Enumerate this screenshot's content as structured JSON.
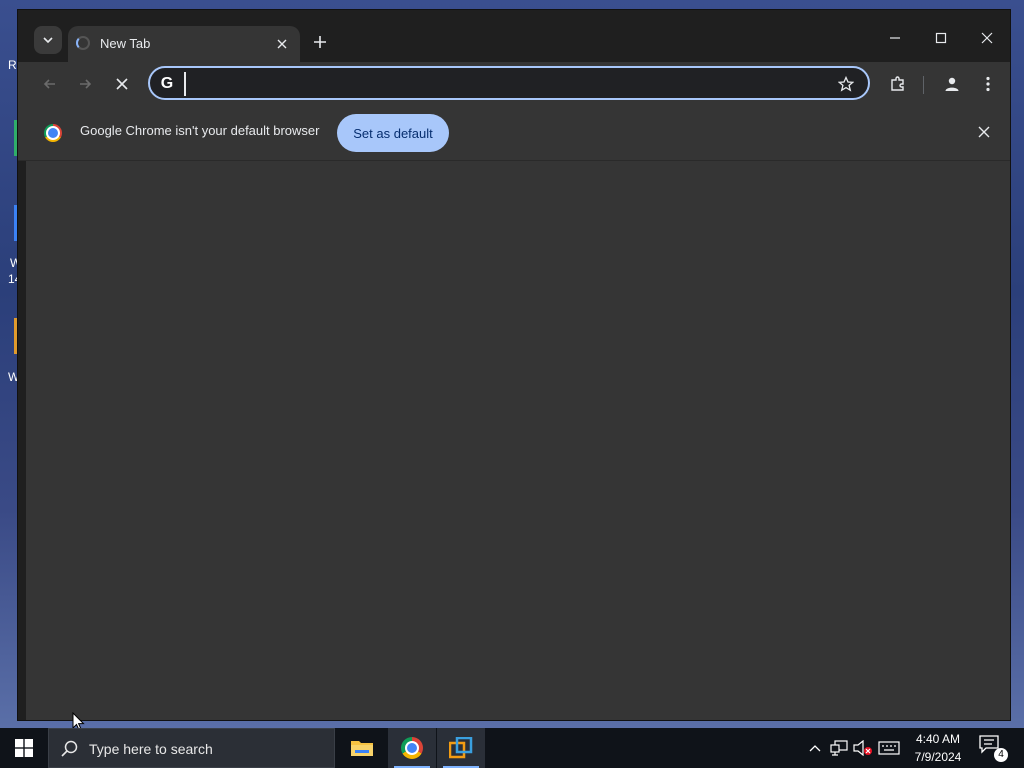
{
  "browser": {
    "tab": {
      "title": "New Tab"
    },
    "omnibox": {
      "value": "",
      "placeholder": ""
    },
    "infobar": {
      "message": "Google Chrome isn't your default browser",
      "button_label": "Set as default"
    }
  },
  "desktop": {
    "icon_labels": [
      "R",
      "W",
      "14",
      "W"
    ]
  },
  "taskbar": {
    "search_placeholder": "Type here to search",
    "apps": [
      "file-explorer-icon",
      "chrome-icon",
      "vmware-icon"
    ],
    "clock": {
      "time": "4:40 AM",
      "date": "7/9/2024"
    },
    "notification_count": "4"
  },
  "colors": {
    "accent": "#a8c7fa",
    "window_bg": "#1f1f1f",
    "toolbar_bg": "#353535"
  }
}
